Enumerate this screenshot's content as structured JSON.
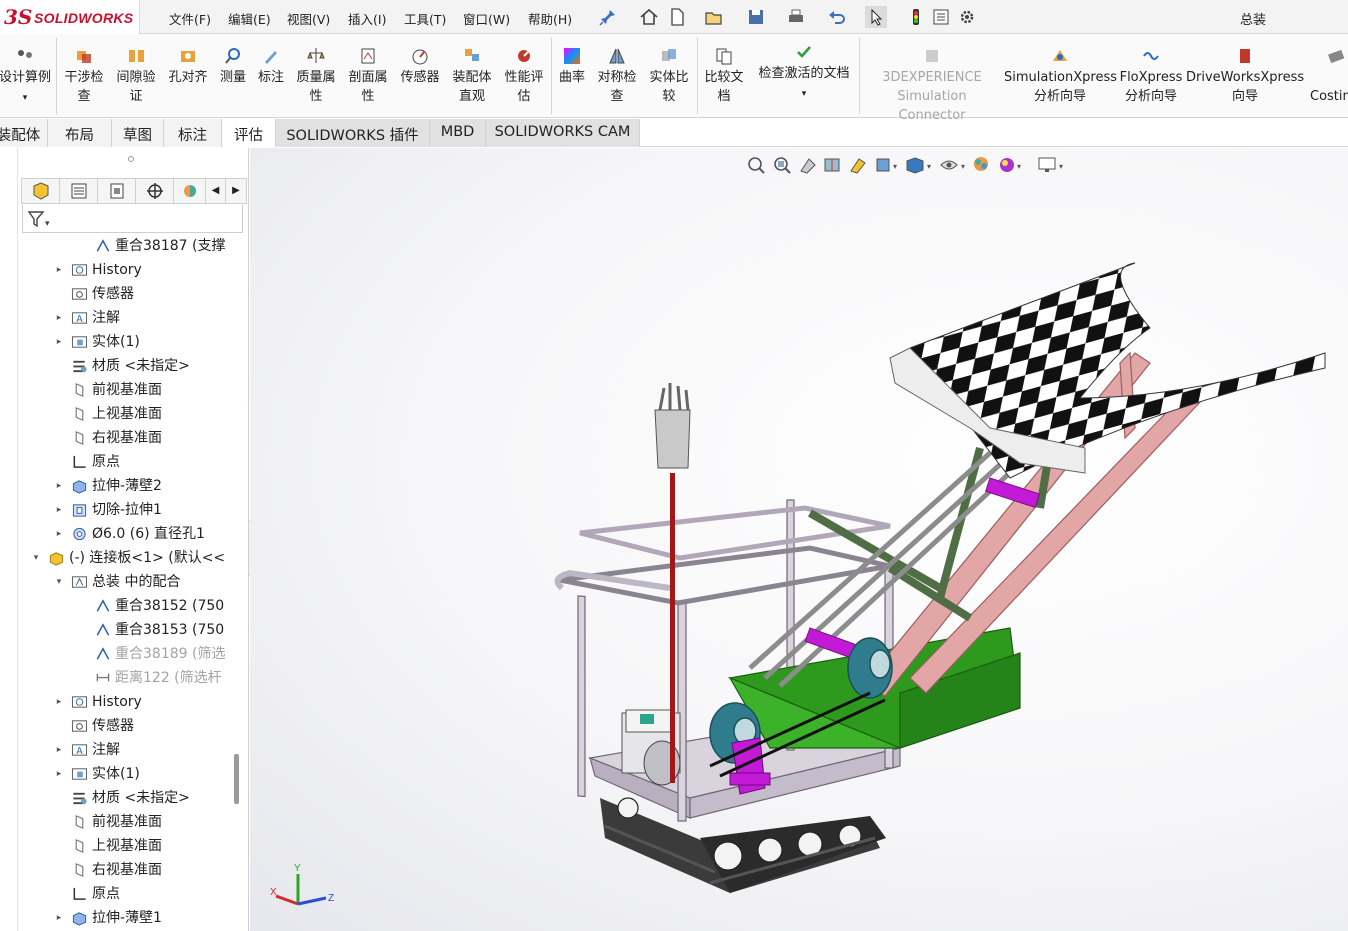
{
  "app": {
    "brand_ds": "3S",
    "brand_name": "SOLIDWORKS",
    "document_title": "总装"
  },
  "menu": {
    "items": [
      "文件(F)",
      "编辑(E)",
      "视图(V)",
      "插入(I)",
      "工具(T)",
      "窗口(W)",
      "帮助(H)"
    ]
  },
  "ribbon": {
    "buttons": [
      {
        "line1": "设计算例",
        "line2": ""
      },
      {
        "line1": "干涉检",
        "line2": "查"
      },
      {
        "line1": "间隙验",
        "line2": "证"
      },
      {
        "line1": "孔对齐",
        "line2": ""
      },
      {
        "line1": "测量",
        "line2": ""
      },
      {
        "line1": "标注",
        "line2": ""
      },
      {
        "line1": "质量属",
        "line2": "性"
      },
      {
        "line1": "剖面属",
        "line2": "性"
      },
      {
        "line1": "传感器",
        "line2": ""
      },
      {
        "line1": "装配体",
        "line2": "直观"
      },
      {
        "line1": "性能评",
        "line2": "估"
      },
      {
        "line1": "曲率",
        "line2": ""
      },
      {
        "line1": "对称检",
        "line2": "查"
      },
      {
        "line1": "实体比",
        "line2": "较"
      },
      {
        "line1": "比较文",
        "line2": "档"
      },
      {
        "line1": "检查激活的文档",
        "line2": ""
      },
      {
        "line1": "3DEXPERIENCE",
        "line2": "Simulation Connector"
      },
      {
        "line1": "SimulationXpress",
        "line2": "分析向导"
      },
      {
        "line1": "FloXpress",
        "line2": "分析向导"
      },
      {
        "line1": "DriveWorksXpress",
        "line2": "向导"
      },
      {
        "line1": "",
        "line2": "Costin"
      }
    ]
  },
  "tabs": [
    "装配体",
    "布局",
    "草图",
    "标注",
    "评估",
    "SOLIDWORKS 插件",
    "MBD",
    "SOLIDWORKS CAM"
  ],
  "active_tab": "评估",
  "feature_tree": {
    "rows": [
      {
        "label": "重合38187 (支撑",
        "icon": "mate-coincident-icon",
        "indent": 2,
        "expander": ""
      },
      {
        "label": "History",
        "icon": "history-folder-icon",
        "indent": 1,
        "expander": "▸"
      },
      {
        "label": "传感器",
        "icon": "sensor-folder-icon",
        "indent": 1,
        "expander": ""
      },
      {
        "label": "注解",
        "icon": "annotation-folder-icon",
        "indent": 1,
        "expander": "▸"
      },
      {
        "label": "实体(1)",
        "icon": "solid-bodies-folder-icon",
        "indent": 1,
        "expander": "▸"
      },
      {
        "label": "材质 <未指定>",
        "icon": "material-icon",
        "indent": 1,
        "expander": ""
      },
      {
        "label": "前视基准面",
        "icon": "plane-icon",
        "indent": 1,
        "expander": ""
      },
      {
        "label": "上视基准面",
        "icon": "plane-icon",
        "indent": 1,
        "expander": ""
      },
      {
        "label": "右视基准面",
        "icon": "plane-icon",
        "indent": 1,
        "expander": ""
      },
      {
        "label": "原点",
        "icon": "origin-icon",
        "indent": 1,
        "expander": ""
      },
      {
        "label": "拉伸-薄壁2",
        "icon": "extrude-icon",
        "indent": 1,
        "expander": "▸"
      },
      {
        "label": "切除-拉伸1",
        "icon": "cut-extrude-icon",
        "indent": 1,
        "expander": "▸"
      },
      {
        "label": "Ø6.0 (6) 直径孔1",
        "icon": "hole-icon",
        "indent": 1,
        "expander": "▸"
      },
      {
        "label": "(-) 连接板<1> (默认<<",
        "icon": "part-icon",
        "indent": 0,
        "expander": "▾"
      },
      {
        "label": "总装 中的配合",
        "icon": "mates-folder-icon",
        "indent": 1,
        "expander": "▾"
      },
      {
        "label": "重合38152 (750",
        "icon": "mate-coincident-icon",
        "indent": 2,
        "expander": ""
      },
      {
        "label": "重合38153 (750",
        "icon": "mate-coincident-icon",
        "indent": 2,
        "expander": ""
      },
      {
        "label": "重合38189 (筛选",
        "icon": "mate-coincident-icon",
        "indent": 2,
        "expander": "",
        "dim": true
      },
      {
        "label": "距离122 (筛选杆",
        "icon": "mate-distance-icon",
        "indent": 2,
        "expander": "",
        "dim": true
      },
      {
        "label": "History",
        "icon": "history-folder-icon",
        "indent": 1,
        "expander": "▸"
      },
      {
        "label": "传感器",
        "icon": "sensor-folder-icon",
        "indent": 1,
        "expander": ""
      },
      {
        "label": "注解",
        "icon": "annotation-folder-icon",
        "indent": 1,
        "expander": "▸"
      },
      {
        "label": "实体(1)",
        "icon": "solid-bodies-folder-icon",
        "indent": 1,
        "expander": "▸"
      },
      {
        "label": "材质 <未指定>",
        "icon": "material-icon",
        "indent": 1,
        "expander": ""
      },
      {
        "label": "前视基准面",
        "icon": "plane-icon",
        "indent": 1,
        "expander": ""
      },
      {
        "label": "上视基准面",
        "icon": "plane-icon",
        "indent": 1,
        "expander": ""
      },
      {
        "label": "右视基准面",
        "icon": "plane-icon",
        "indent": 1,
        "expander": ""
      },
      {
        "label": "原点",
        "icon": "origin-icon",
        "indent": 1,
        "expander": ""
      },
      {
        "label": "拉伸-薄壁1",
        "icon": "extrude-icon",
        "indent": 1,
        "expander": "▸"
      }
    ]
  },
  "triad": {
    "x": "X",
    "y": "Y",
    "z": "Z"
  },
  "colors": {
    "brand_red": "#c8102e",
    "frame_gray": "#c9c3cf",
    "hopper_green": "#2e9a1d",
    "link_green": "#4f6e46",
    "rail_pink": "#d99a9a",
    "cylinder_magenta": "#c21ad6",
    "gear_teal": "#2f7c8c",
    "track_dark": "#333333",
    "post_red": "#a01818"
  }
}
